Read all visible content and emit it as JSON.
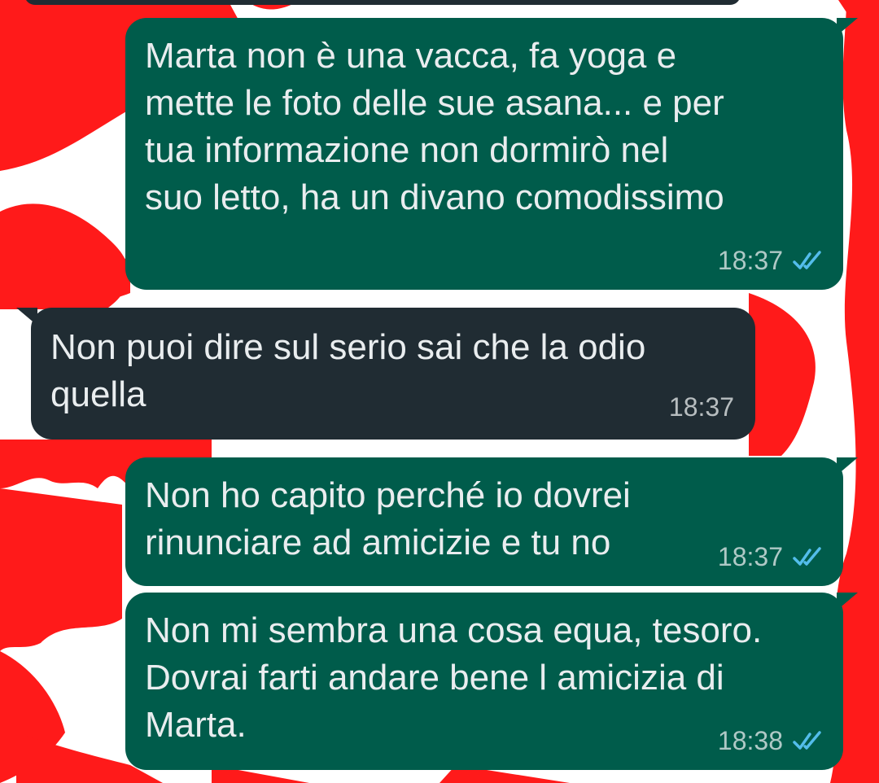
{
  "colors": {
    "wallpaper_red": "#ff1a1a",
    "wallpaper_white": "#ffffff",
    "outgoing_bubble": "#005c4b",
    "incoming_bubble": "#202c33",
    "read_tick_blue": "#53bdeb",
    "message_text": "#e9edef"
  },
  "messages": [
    {
      "direction": "outgoing",
      "text": "Marta non è una vacca, fa yoga e\nmette le foto delle sue asana... e per\ntua informazione non dormirò nel\nsuo letto, ha un divano comodissimo",
      "time": "18:37",
      "status_icon": "double-check-read-icon"
    },
    {
      "direction": "incoming",
      "text": "Non puoi dire sul serio sai che la odio\nquella",
      "time": "18:37"
    },
    {
      "direction": "outgoing",
      "text": "Non ho capito perché io dovrei\nrinunciare ad amicizie e tu no",
      "time": "18:37",
      "status_icon": "double-check-read-icon"
    },
    {
      "direction": "outgoing",
      "text": "Non mi sembra una cosa equa, tesoro.\nDovrai farti andare bene l amicizia di\nMarta.",
      "time": "18:38",
      "status_icon": "double-check-read-icon"
    }
  ]
}
